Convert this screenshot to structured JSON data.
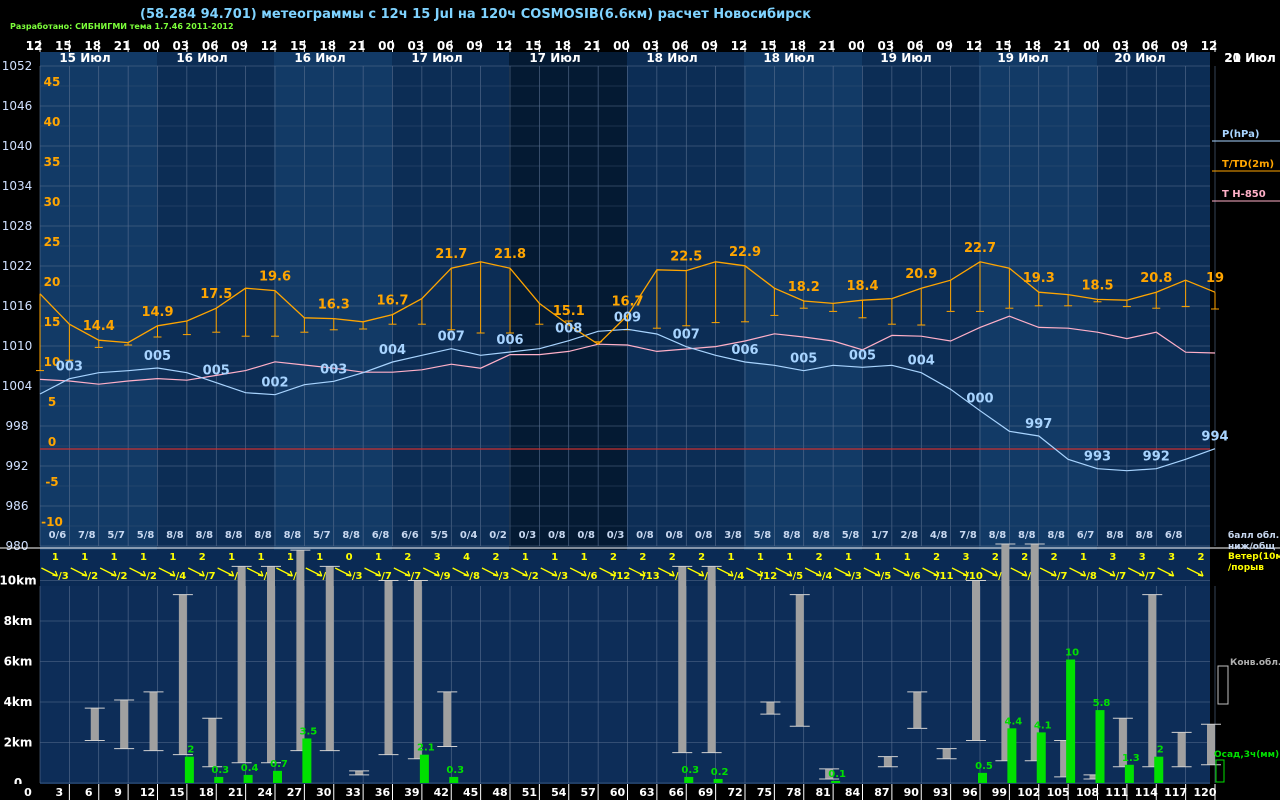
{
  "title": "(58.284 94.701) метеограммы с  12ч 15 Jul на 120ч COSMOSIB(6.6км) расчет Новосибирск",
  "credit": "Разработано: СИБНИГМИ тема 1.7.46 2011-2012",
  "hours_top": [
    "12",
    "15",
    "18",
    "21",
    "00",
    "03",
    "06",
    "09",
    "12",
    "15",
    "18",
    "21",
    "00",
    "03",
    "06",
    "09",
    "12",
    "15",
    "18",
    "21",
    "00",
    "03",
    "06",
    "09",
    "12",
    "15",
    "18",
    "21",
    "00",
    "03",
    "06",
    "09",
    "12",
    "15",
    "18",
    "21",
    "00",
    "03",
    "06",
    "09",
    "12"
  ],
  "day_labels": [
    "15 Июл",
    "16 Июл",
    "16 Июл",
    "17 Июл",
    "17 Июл",
    "18 Июл",
    "18 Июл",
    "19 Июл",
    "19 Июл",
    "20 Июл",
    "20 Июл",
    "21 Июл"
  ],
  "pressure_ticks": [
    "1052",
    "1046",
    "1040",
    "1034",
    "1028",
    "1022",
    "1016",
    "1010",
    "1004",
    "998",
    "992",
    "986",
    "980"
  ],
  "temp_ticks": [
    "45",
    "40",
    "35",
    "30",
    "25",
    "20",
    "15",
    "10",
    "5",
    "0",
    "-5",
    "-10"
  ],
  "legend": {
    "p": "P(hPa)",
    "t": "T/TD(2m)",
    "t850": "T H-850",
    "cloud_ball": "балл обл.",
    "cloud_levels": "ниж/общ",
    "wind": "Ветер(10м)",
    "gust": "/порыв",
    "conv": "Конв.обл.",
    "precip": "Осад,3ч(мм)"
  },
  "height_ticks": [
    "10km",
    "8km",
    "6km",
    "4km",
    "2km",
    "0"
  ],
  "colors": {
    "pressure": "#a8d4ff",
    "temp": "#ffa500",
    "t850": "#ffb0c8",
    "precip": "#00e000",
    "cloud": "#a0a0a0",
    "wind": "#ffff00",
    "grid": "#5a7090",
    "zero": "#c83030"
  },
  "chart_data": {
    "type": "line",
    "x": [
      "12",
      "15",
      "18",
      "21",
      "00",
      "03",
      "06",
      "09",
      "12",
      "15",
      "18",
      "21",
      "00",
      "03",
      "06",
      "09",
      "12",
      "15",
      "18",
      "21",
      "00",
      "03",
      "06",
      "09",
      "12",
      "15",
      "18",
      "21",
      "00",
      "03",
      "06",
      "09",
      "12",
      "15",
      "18",
      "21",
      "00",
      "03",
      "06",
      "09",
      "12"
    ],
    "pressure_hpa": [
      1002.8,
      1005.1,
      1006.0,
      1006.3,
      1006.7,
      1006.0,
      1004.5,
      1003.0,
      1002.7,
      1004.2,
      1004.7,
      1006.0,
      1007.6,
      1008.6,
      1009.6,
      1008.6,
      1009.1,
      1009.6,
      1010.8,
      1012.2,
      1012.5,
      1011.8,
      1009.9,
      1008.6,
      1007.6,
      1007.1,
      1006.3,
      1007.1,
      1006.8,
      1007.1,
      1006.0,
      1003.5,
      1000.3,
      997.2,
      996.5,
      993.0,
      991.6,
      991.3,
      991.6,
      993.0,
      994.6
    ],
    "pressure_labels": [
      {
        "i": 1,
        "text": "003"
      },
      {
        "i": 4,
        "text": "005"
      },
      {
        "i": 6,
        "text": "005"
      },
      {
        "i": 8,
        "text": "002"
      },
      {
        "i": 10,
        "text": "003"
      },
      {
        "i": 12,
        "text": "004"
      },
      {
        "i": 14,
        "text": "007"
      },
      {
        "i": 16,
        "text": "006"
      },
      {
        "i": 18,
        "text": "008"
      },
      {
        "i": 20,
        "text": "009"
      },
      {
        "i": 22,
        "text": "007"
      },
      {
        "i": 24,
        "text": "006"
      },
      {
        "i": 26,
        "text": "005"
      },
      {
        "i": 28,
        "text": "005"
      },
      {
        "i": 30,
        "text": "004"
      },
      {
        "i": 32,
        "text": "000"
      },
      {
        "i": 34,
        "text": "997"
      },
      {
        "i": 36,
        "text": "993"
      },
      {
        "i": 38,
        "text": "992"
      },
      {
        "i": 40,
        "text": "994"
      }
    ],
    "temp_2m": [
      19.4,
      15.6,
      13.6,
      13.3,
      15.4,
      16.0,
      17.6,
      20.1,
      19.8,
      16.4,
      16.3,
      15.9,
      16.8,
      18.8,
      22.6,
      23.4,
      22.6,
      18.2,
      15.5,
      13.1,
      16.7,
      22.4,
      22.3,
      23.4,
      22.9,
      20.1,
      18.5,
      18.2,
      18.6,
      18.8,
      20.1,
      21.1,
      23.4,
      22.6,
      19.6,
      19.3,
      18.7,
      18.6,
      19.6,
      21.1,
      19.6
    ],
    "dewpoint_2m": [
      9.8,
      11.1,
      12.7,
      13.0,
      14.0,
      14.3,
      14.6,
      14.1,
      14.1,
      14.6,
      14.9,
      15.0,
      15.6,
      15.6,
      14.9,
      14.5,
      14.5,
      15.6,
      16.0,
      13.4,
      14.9,
      15.1,
      15.4,
      15.8,
      15.9,
      16.7,
      17.6,
      17.2,
      16.4,
      15.6,
      15.5,
      17.2,
      17.2,
      17.6,
      17.9,
      17.9,
      18.4,
      17.8,
      17.6,
      17.8,
      17.5
    ],
    "temp_labels": [
      {
        "i": 2,
        "text": "14.4"
      },
      {
        "i": 4,
        "text": "14.9"
      },
      {
        "i": 6,
        "text": "17.5"
      },
      {
        "i": 8,
        "text": "19.6"
      },
      {
        "i": 10,
        "text": "16.3"
      },
      {
        "i": 12,
        "text": "16.7"
      },
      {
        "i": 14,
        "text": "21.7"
      },
      {
        "i": 16,
        "text": "21.8"
      },
      {
        "i": 18,
        "text": "15.1"
      },
      {
        "i": 20,
        "text": "16.7"
      },
      {
        "i": 22,
        "text": "22.5"
      },
      {
        "i": 24,
        "text": "22.9"
      },
      {
        "i": 26,
        "text": "18.2"
      },
      {
        "i": 28,
        "text": "18.4"
      },
      {
        "i": 30,
        "text": "20.9"
      },
      {
        "i": 32,
        "text": "22.7"
      },
      {
        "i": 34,
        "text": "19.3"
      },
      {
        "i": 36,
        "text": "18.5"
      },
      {
        "i": 38,
        "text": "20.8"
      },
      {
        "i": 40,
        "text": "19"
      }
    ],
    "temp_850": [
      8.7,
      8.5,
      8.1,
      8.5,
      8.8,
      8.6,
      9.2,
      9.8,
      10.9,
      10.5,
      10.1,
      9.6,
      9.6,
      9.9,
      10.6,
      10.1,
      11.8,
      11.8,
      12.2,
      13.1,
      13.0,
      12.2,
      12.5,
      12.8,
      13.5,
      14.4,
      14.0,
      13.5,
      12.4,
      14.2,
      14.1,
      13.5,
      15.2,
      16.6,
      15.2,
      15.1,
      14.6,
      13.8,
      14.6,
      12.1,
      12.0
    ],
    "clouds": [
      "0/6",
      "7/8",
      "5/7",
      "5/8",
      "8/8",
      "8/8",
      "8/8",
      "8/8",
      "8/8",
      "5/7",
      "8/8",
      "6/8",
      "6/6",
      "5/5",
      "0/4",
      "0/2",
      "0/3",
      "0/8",
      "0/8",
      "0/3",
      "0/8",
      "0/8",
      "0/8",
      "3/8",
      "5/8",
      "8/8",
      "8/8",
      "5/8",
      "1/7",
      "2/8",
      "4/8",
      "7/8",
      "8/8",
      "8/8",
      "8/8",
      "6/7",
      "8/8",
      "8/8",
      "6/8"
    ],
    "wind_speed": [
      "1",
      "1",
      "1",
      "1",
      "1",
      "2",
      "1",
      "1",
      "1",
      "1",
      "0",
      "1",
      "2",
      "3",
      "4",
      "2",
      "1",
      "1",
      "1",
      "2",
      "2",
      "2",
      "2",
      "1",
      "1",
      "1",
      "2",
      "1",
      "1",
      "1",
      "2",
      "3",
      "2",
      "2",
      "2",
      "1",
      "3",
      "3",
      "3",
      "2"
    ],
    "wind_gust": [
      "/3",
      "/2",
      "/2",
      "/2",
      "/4",
      "/7",
      "/9",
      "/9",
      "/9",
      "/2",
      "/3",
      "/7",
      "/7",
      "/9",
      "/8",
      "/3",
      "/2",
      "/3",
      "/6",
      "/12",
      "/13",
      "/5",
      "/3",
      "/4",
      "/12",
      "/5",
      "/4",
      "/3",
      "/5",
      "/6",
      "/11",
      "/10",
      "/8",
      "/5",
      "/7",
      "/8",
      "/7",
      "/7"
    ],
    "precip_3h_mm": [
      [
        15,
        "2",
        1.3
      ],
      [
        18,
        "0.3",
        0.3
      ],
      [
        21,
        "0.4",
        0.4
      ],
      [
        24,
        "0.7",
        0.6
      ],
      [
        27,
        "3.5",
        2.2
      ],
      [
        39,
        "2.1",
        1.4
      ],
      [
        42,
        "0.3",
        0.3
      ],
      [
        66,
        "0.3",
        0.3
      ],
      [
        69,
        "0.2",
        0.2
      ],
      [
        81,
        "0.1",
        0.1
      ],
      [
        96,
        "0.5",
        0.5
      ],
      [
        99,
        "4.4",
        2.7
      ],
      [
        102,
        "4.1",
        2.5
      ],
      [
        105,
        "10",
        6.1
      ],
      [
        108,
        "5.8",
        3.6
      ],
      [
        111,
        "1.3",
        0.9
      ],
      [
        114,
        "2",
        1.3
      ]
    ],
    "conv_clouds_km": [
      [
        6,
        2.1,
        3.7
      ],
      [
        9,
        1.7,
        4.1
      ],
      [
        12,
        1.6,
        4.5
      ],
      [
        15,
        1.4,
        9.3
      ],
      [
        18,
        0.8,
        3.2
      ],
      [
        21,
        1.0,
        10.7
      ],
      [
        24,
        1.0,
        10.7
      ],
      [
        27,
        1.6,
        11.5
      ],
      [
        30,
        1.6,
        10.7
      ],
      [
        33,
        0.4,
        0.6
      ],
      [
        36,
        1.4,
        10.0
      ],
      [
        39,
        1.2,
        10.0
      ],
      [
        42,
        1.8,
        4.5
      ],
      [
        66,
        1.5,
        10.7
      ],
      [
        69,
        1.5,
        10.7
      ],
      [
        75,
        3.4,
        4.0
      ],
      [
        78,
        2.8,
        9.3
      ],
      [
        81,
        0.2,
        0.7
      ],
      [
        87,
        0.8,
        1.3
      ],
      [
        90,
        2.7,
        4.5
      ],
      [
        93,
        1.2,
        1.7
      ],
      [
        96,
        2.1,
        10.0
      ],
      [
        99,
        1.1,
        11.8
      ],
      [
        102,
        1.1,
        11.8
      ],
      [
        105,
        0.3,
        2.1
      ],
      [
        108,
        0.2,
        0.4
      ],
      [
        111,
        0.8,
        3.2
      ],
      [
        114,
        0.8,
        9.3
      ],
      [
        117,
        0.8,
        2.5
      ],
      [
        120,
        0.9,
        2.9
      ]
    ],
    "x_ticks_bottom": [
      "3",
      "6",
      "9",
      "12",
      "15",
      "18",
      "21",
      "24",
      "27",
      "30",
      "33",
      "36",
      "39",
      "42",
      "45",
      "48",
      "51",
      "54",
      "57",
      "60",
      "63",
      "66",
      "69",
      "72",
      "75",
      "78",
      "81",
      "84",
      "87",
      "90",
      "93",
      "96",
      "99",
      "102",
      "105",
      "108",
      "111",
      "114",
      "117",
      "120"
    ],
    "ylim_pressure": [
      980,
      1052
    ],
    "ylim_temp": [
      -10,
      45
    ],
    "ylim_height_km": [
      0,
      11
    ]
  }
}
